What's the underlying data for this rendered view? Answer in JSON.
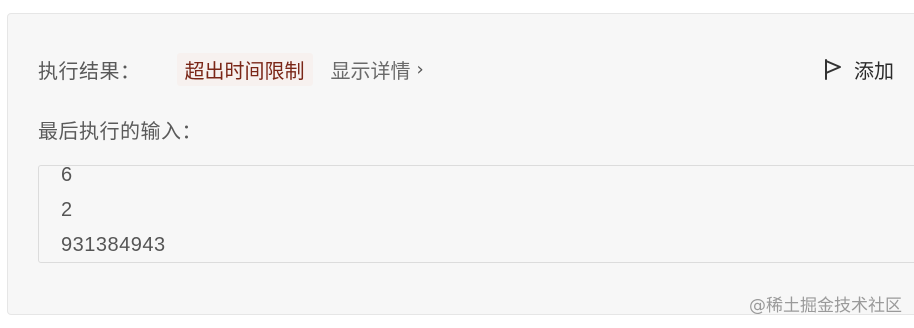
{
  "result": {
    "label": "执行结果：",
    "status": "超出时间限制",
    "details_label": "显示详情",
    "details_chevron": "›",
    "add_label": "添加"
  },
  "last_input": {
    "label": "最后执行的输入：",
    "lines": [
      "6",
      "2",
      "931384943"
    ]
  },
  "watermark": "@稀土掘金技术社区",
  "icons": {
    "flag": "flag-icon",
    "chevron": "chevron-right-icon"
  },
  "colors": {
    "status_text": "#7a2617",
    "status_bg": "#f7f1ef",
    "panel_bg": "#f7f7f7"
  }
}
